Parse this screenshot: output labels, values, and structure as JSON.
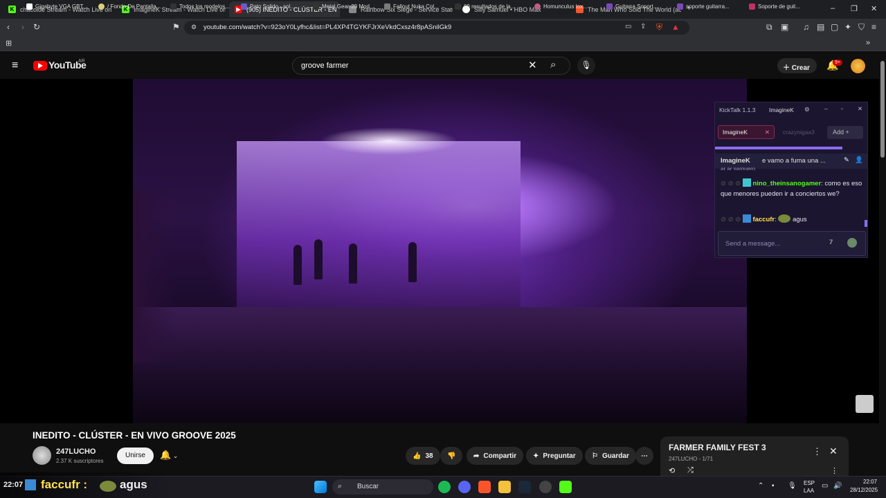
{
  "tabs": [
    {
      "title": "chacoide Stream - Watch Live on Kick",
      "favicon": "kick-icon",
      "color": "#53fc18"
    },
    {
      "title": "ImagineK Stream - Watch Live on",
      "favicon": "kick-icon",
      "color": "#53fc18"
    },
    {
      "title": "(905) INEDITO - CLÚSTER - EN",
      "favicon": "youtube-icon",
      "color": "#ff0000",
      "active": true
    },
    {
      "title": "Rainbow Six Siege - Service Status | U",
      "favicon": "r6-icon",
      "color": "#cccccc"
    },
    {
      "title": "Silly Samuel • HBO Max",
      "favicon": "hbo-icon",
      "color": "#ffffff"
    },
    {
      "title": "The Man Who Sold The World (acord",
      "favicon": "brave-icon",
      "color": "#fb542b"
    }
  ],
  "address": {
    "url": "youtube.com/watch?v=923oY0Lyfhc&list=PL4XP4TGYKFJrXeVkdCxsz4r8pASnilGk9"
  },
  "bookmarks": [
    "Gigabyte VGA GBT...",
    "/ Fondo De Pantalla...",
    "Todos los modelos...",
    "Pato Solido - sol...",
    "Metal Gear-20 Mod...",
    "Fallout Nuka Col...",
    "69 resultados de la...",
    "Homunculus lox...",
    "Guitarra Soport...",
    "soporte guitarra...",
    "Soporte de guit..."
  ],
  "youtube": {
    "logo": "YouTube",
    "region": "AR",
    "search_value": "groove farmer",
    "create_label": "Crear",
    "notif_count": "9+"
  },
  "kicktalk": {
    "app": "KickTalk 1.1.3",
    "user": "ImagineK",
    "tab_active": "ImagineK",
    "tab_other": "crazynigaa3",
    "add_label": "Add +",
    "pinned_user": "ImagineK",
    "pinned_text": "e vamo a fuma una ...",
    "messages": [
      {
        "user": "nino_theinsanogamer",
        "text": "como es eso que menores pueden ir a conciertos we?",
        "color": "#53fc18"
      },
      {
        "user": "faccufr",
        "text": "agus",
        "color": "#ffe34d"
      }
    ],
    "placeholder": "Send a message...",
    "partial_text": "ar ar sarquero"
  },
  "video": {
    "title": "INEDITO - CLÚSTER - EN VIVO GROOVE 2025",
    "channel": "247LUCHO",
    "subs": "2.37 K suscriptores",
    "join": "Unirse",
    "likes": "38",
    "share": "Compartir",
    "ask": "Preguntar",
    "save": "Guardar"
  },
  "playlist": {
    "title": "FARMER FAMILY FEST 3",
    "meta": "247LUCHO - 1/71"
  },
  "overlay": {
    "time": "22:07",
    "user": "faccufr :",
    "msg": "agus"
  },
  "taskbar": {
    "search": "Buscar",
    "lang1": "ESP",
    "lang2": "LAA",
    "time": "22:07",
    "date": "28/12/2025"
  }
}
